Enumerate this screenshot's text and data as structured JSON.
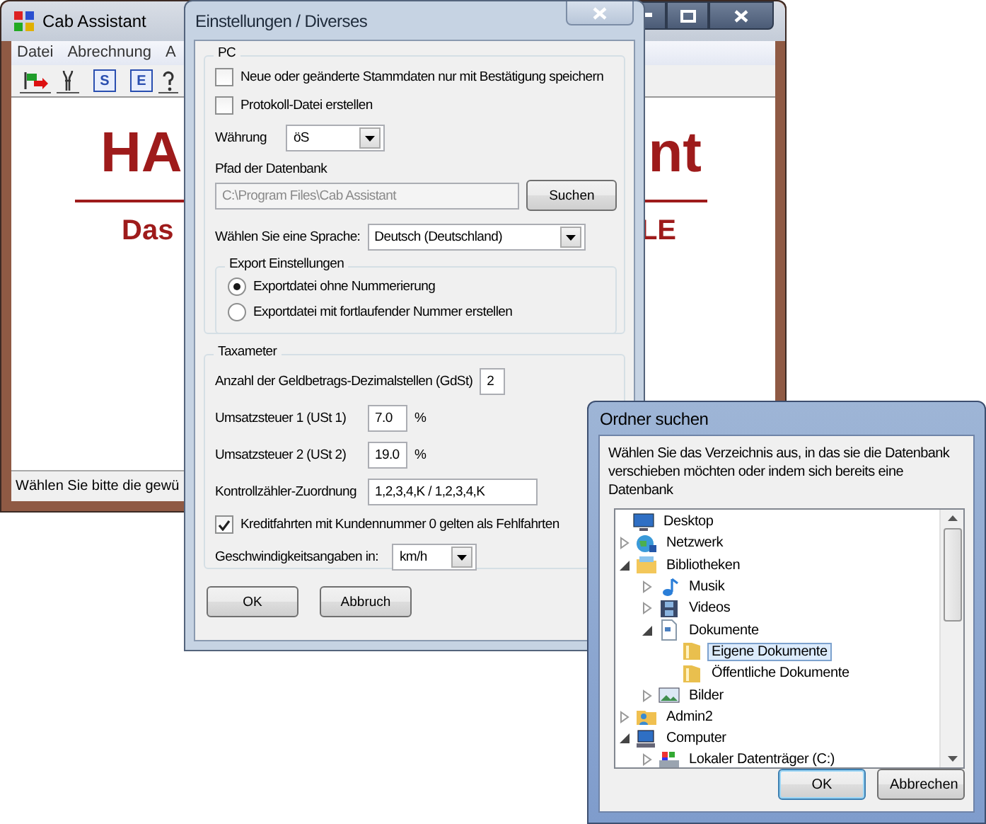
{
  "main_window": {
    "title": "Cab Assistant",
    "menu": [
      "Datei",
      "Abrechnung",
      "A"
    ],
    "toolbar": [
      {
        "kind": "flag"
      },
      {
        "kind": "tool"
      },
      {
        "kind": "letter",
        "label": "S"
      },
      {
        "kind": "letter",
        "label": "E"
      },
      {
        "kind": "help"
      }
    ],
    "banner": {
      "title_left": "HA",
      "title_right": "nt",
      "subtitle_left": "Das",
      "subtitle_right": "LE"
    },
    "status_bar": "Wählen Sie bitte die gewü"
  },
  "settings_dialog": {
    "title": "Einstellungen / Diverses",
    "pc_group": {
      "title": "PC",
      "options": [
        {
          "label": "Neue oder geänderte Stammdaten nur mit Bestätigung speichern",
          "checked": false
        },
        {
          "label": "Protokoll-Datei erstellen",
          "checked": false
        }
      ],
      "currency": {
        "label": "Währung",
        "value": "öS"
      },
      "db_path": {
        "label": "Pfad der Datenbank",
        "value": "C:\\Program Files\\Cab Assistant",
        "disabled": true,
        "button": "Suchen"
      },
      "language": {
        "label": "Wählen Sie eine Sprache:",
        "value": "Deutsch (Deutschland)"
      },
      "export_group": {
        "title": "Export Einstellungen",
        "options": [
          {
            "label": "Exportdatei ohne Nummerierung",
            "selected": true
          },
          {
            "label": "Exportdatei mit fortlaufender Nummer erstellen",
            "selected": false
          }
        ]
      }
    },
    "taxameter_group": {
      "title": "Taxameter",
      "fields": [
        {
          "label": "Anzahl der Geldbetrags-Dezimalstellen (GdSt)",
          "value": "2"
        },
        {
          "label": "Umsatzsteuer 1 (USt 1)",
          "value": "7.0",
          "unit": "%"
        },
        {
          "label": "Umsatzsteuer 2 (USt 2)",
          "value": "19.0",
          "unit": "%"
        },
        {
          "label": "Kontrollzähler-Zuordnung",
          "value": "1,2,3,4,K / 1,2,3,4,K"
        }
      ],
      "credit_option": {
        "label": "Kreditfahrten mit Kundennummer 0 gelten als Fehlfahrten",
        "checked": true
      },
      "speed": {
        "label": "Geschwindigkeitsangaben in:",
        "value": "km/h"
      }
    },
    "buttons": [
      "OK",
      "Abbruch"
    ]
  },
  "folder_dialog": {
    "title": "Ordner suchen",
    "description": "Wählen Sie das Verzeichnis aus, in das sie die Datenbank verschieben möchten oder indem sich bereits eine Datenbank",
    "tree": [
      {
        "label": "Desktop",
        "kind": "monitor",
        "selected": false,
        "children": [
          {
            "label": "Netzwerk",
            "kind": "globe",
            "expanded": false,
            "selected": false
          },
          {
            "label": "Bibliotheken",
            "kind": "library",
            "expanded": true,
            "selected": false,
            "children": [
              {
                "label": "Musik",
                "kind": "music",
                "expanded": false,
                "selected": false
              },
              {
                "label": "Videos",
                "kind": "film",
                "expanded": false,
                "selected": false
              },
              {
                "label": "Dokumente",
                "kind": "document",
                "expanded": true,
                "selected": false,
                "children": [
                  {
                    "label": "Eigene Dokumente",
                    "kind": "folder",
                    "selected": true
                  },
                  {
                    "label": "Öffentliche Dokumente",
                    "kind": "folder",
                    "selected": false
                  }
                ]
              },
              {
                "label": "Bilder",
                "kind": "image",
                "expanded": false,
                "selected": false
              }
            ]
          },
          {
            "label": "Admin2",
            "kind": "user",
            "expanded": false,
            "selected": false
          },
          {
            "label": "Computer",
            "kind": "computer",
            "expanded": true,
            "selected": false,
            "children": [
              {
                "label": "Lokaler Datenträger (C:)",
                "kind": "drive",
                "expanded": false,
                "selected": false
              }
            ]
          }
        ]
      }
    ],
    "buttons": [
      {
        "label": "OK",
        "default": true
      },
      {
        "label": "Abbrechen",
        "default": false
      }
    ]
  }
}
